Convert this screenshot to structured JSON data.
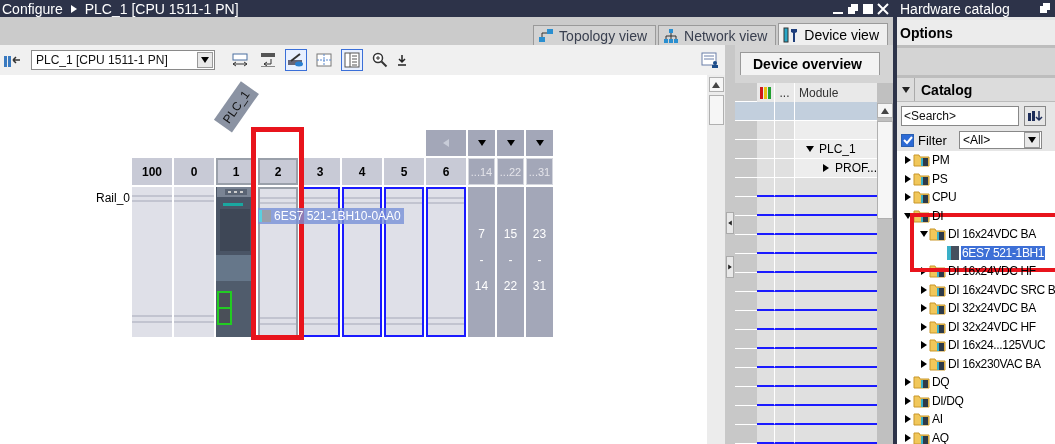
{
  "editor": {
    "breadcrumb": [
      "Configure",
      "PLC_1 [CPU 1511-1 PN]"
    ]
  },
  "view_tabs": [
    {
      "label": "Topology view",
      "kind": "topology",
      "selected": false
    },
    {
      "label": "Network view",
      "kind": "network",
      "selected": false
    },
    {
      "label": "Device view",
      "kind": "device",
      "selected": true
    }
  ],
  "toolbar": {
    "device_select": "PLC_1 [CPU 1511-1 PN]",
    "buttons": [
      {
        "kind": "spacing",
        "pressed": false
      },
      {
        "kind": "names",
        "pressed": false
      },
      {
        "kind": "view",
        "pressed": true
      },
      {
        "kind": "grid",
        "pressed": false
      },
      {
        "kind": "table",
        "pressed": true
      },
      {
        "kind": "zoom",
        "pressed": false
      }
    ]
  },
  "rack": {
    "device_label": "PLC_1",
    "rail_label": "Rail_0",
    "drag_label": "6ES7 521-1BH10-0AA0",
    "slots": [
      {
        "label": "100",
        "kind": "empty"
      },
      {
        "label": "0",
        "kind": "empty"
      },
      {
        "label": "1",
        "kind": "cpu"
      },
      {
        "label": "2",
        "kind": "hover"
      },
      {
        "label": "3",
        "kind": "target"
      },
      {
        "label": "4",
        "kind": "target"
      },
      {
        "label": "5",
        "kind": "target"
      },
      {
        "label": "6",
        "kind": "target"
      }
    ],
    "groups": [
      {
        "label": "...14",
        "range": [
          "7",
          "-",
          "14"
        ]
      },
      {
        "label": "...22",
        "range": [
          "15",
          "-",
          "22"
        ]
      },
      {
        "label": "...31",
        "range": [
          "23",
          "-",
          "31"
        ]
      }
    ]
  },
  "device_overview": {
    "tab": "Device overview",
    "columns": [
      "...",
      "Module"
    ],
    "rows": [
      {
        "kind": "rack",
        "selected": true
      },
      {
        "kind": "slot",
        "selected": false
      },
      {
        "kind": "device",
        "label": "PLC_1",
        "expanded": true,
        "selected": false
      },
      {
        "kind": "interface",
        "label": "PROF...",
        "expanded": false,
        "selected": false
      }
    ]
  },
  "catalog": {
    "title": "Hardware catalog",
    "options": "Options",
    "section": {
      "label": "Catalog",
      "expanded": true
    },
    "search": {
      "placeholder": "<Search>"
    },
    "filter": {
      "label": "Filter",
      "checked": true,
      "value": "<All>"
    },
    "tree": [
      {
        "label": "PM",
        "kind": "folder",
        "expanded": false,
        "selected": false
      },
      {
        "label": "PS",
        "kind": "folder",
        "expanded": false,
        "selected": false
      },
      {
        "label": "CPU",
        "kind": "folder",
        "expanded": false,
        "selected": false
      },
      {
        "label": "DI",
        "kind": "folder",
        "expanded": true,
        "selected": false,
        "children": [
          {
            "label": "DI 16x24VDC BA",
            "kind": "folder",
            "expanded": true,
            "selected": false,
            "children": [
              {
                "label": "6ES7 521-1BH1",
                "kind": "module",
                "selected": true
              }
            ]
          },
          {
            "label": "DI 16x24VDC HF",
            "kind": "folder",
            "expanded": false,
            "selected": false
          },
          {
            "label": "DI 16x24VDC SRC B",
            "kind": "folder",
            "expanded": false,
            "selected": false
          },
          {
            "label": "DI 32x24VDC BA",
            "kind": "folder",
            "expanded": false,
            "selected": false
          },
          {
            "label": "DI 32x24VDC HF",
            "kind": "folder",
            "expanded": false,
            "selected": false
          },
          {
            "label": "DI 16x24...125VUC",
            "kind": "folder",
            "expanded": false,
            "selected": false
          },
          {
            "label": "DI 16x230VAC BA",
            "kind": "folder",
            "expanded": false,
            "selected": false
          }
        ]
      },
      {
        "label": "DQ",
        "kind": "folder",
        "expanded": false,
        "selected": false
      },
      {
        "label": "DI/DQ",
        "kind": "folder",
        "expanded": false,
        "selected": false
      },
      {
        "label": "AI",
        "kind": "folder",
        "expanded": false,
        "selected": false
      },
      {
        "label": "AQ",
        "kind": "folder",
        "expanded": false,
        "selected": false
      }
    ]
  }
}
